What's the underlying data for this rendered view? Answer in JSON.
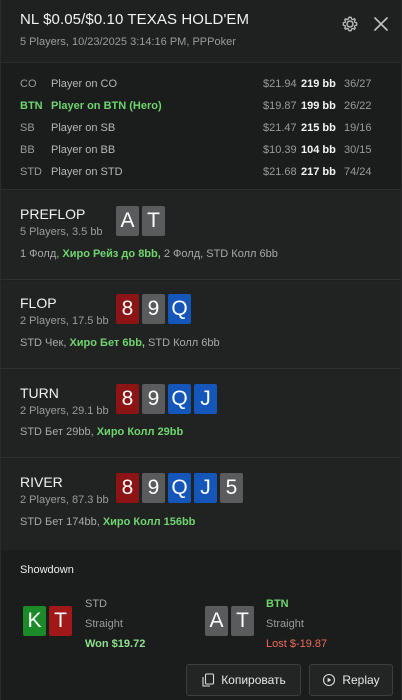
{
  "header": {
    "title": "NL $0.05/$0.10 TEXAS HOLD'EM",
    "subtitle": "5 Players, 10/23/2025 3:14:16 PM, PPPoker",
    "settings_icon": "gear-icon",
    "close_icon": "close-icon"
  },
  "players": [
    {
      "pos": "CO",
      "name": "Player on CO",
      "money": "$21.94",
      "bb": "219 bb",
      "stats": "36/27",
      "hero": false
    },
    {
      "pos": "BTN",
      "name": "Player on BTN (Hero)",
      "money": "$19.87",
      "bb": "199 bb",
      "stats": "26/22",
      "hero": true
    },
    {
      "pos": "SB",
      "name": "Player on SB",
      "money": "$21.47",
      "bb": "215 bb",
      "stats": "19/16",
      "hero": false
    },
    {
      "pos": "BB",
      "name": "Player on BB",
      "money": "$10.39",
      "bb": "104 bb",
      "stats": "30/15",
      "hero": false
    },
    {
      "pos": "STD",
      "name": "Player on STD",
      "money": "$21.68",
      "bb": "217 bb",
      "stats": "74/24",
      "hero": false
    }
  ],
  "streets": {
    "preflop": {
      "name": "PREFLOP",
      "sub": "5 Players, 3.5 bb",
      "cards": [
        "A",
        "T"
      ],
      "act_a": "1 Фолд, ",
      "act_hl": "Хиро Рейз до 8bb,",
      "act_b": " 2 Фолд, STD Колл 6bb"
    },
    "flop": {
      "name": "FLOP",
      "sub": "2 Players, 17.5 bb",
      "cards": [
        "8",
        "9",
        "Q"
      ],
      "act_a": "STD Чек, ",
      "act_hl": "Хиро Бет 6bb,",
      "act_b": " STD Колл 6bb"
    },
    "turn": {
      "name": "TURN",
      "sub": "2 Players, 29.1 bb",
      "cards": [
        "8",
        "9",
        "Q",
        "J"
      ],
      "act_a": "STD Бет 29bb, ",
      "act_hl": "Хиро Колл 29bb",
      "act_b": ""
    },
    "river": {
      "name": "RIVER",
      "sub": "2 Players, 87.3 bb",
      "cards": [
        "8",
        "9",
        "Q",
        "J",
        "5"
      ],
      "act_a": "STD Бет 174bb, ",
      "act_hl": "Хиро Колл 156bb",
      "act_b": ""
    }
  },
  "showdown": {
    "title": "Showdown",
    "left": {
      "cards": [
        "K",
        "T"
      ],
      "pos": "STD",
      "hand": "Straight",
      "result": "Won $19.72"
    },
    "right": {
      "cards": [
        "A",
        "T"
      ],
      "pos": "BTN",
      "hand": "Straight",
      "result": "Lost $-19.87"
    }
  },
  "footer": {
    "copy_label": "Копировать",
    "replay_label": "Replay"
  },
  "colors": {
    "hero_green": "#6fd66f",
    "won_green": "#8fe08f",
    "lost_red": "#ef6a5a",
    "card_red": "#8c1414",
    "card_blue": "#1456b9",
    "card_grey": "#5a5b5c",
    "card_green": "#1b8a29"
  }
}
